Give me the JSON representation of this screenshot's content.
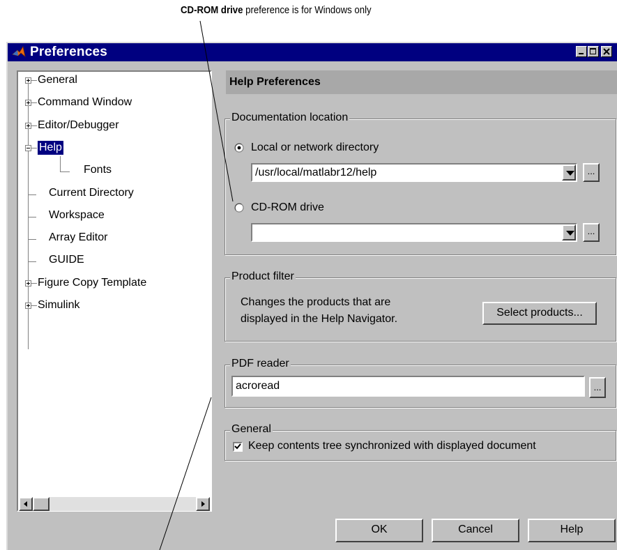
{
  "annotations": {
    "top_bold": "CD-ROM drive",
    "top_rest": " preference is for Windows only"
  },
  "window": {
    "title": "Preferences",
    "controls": [
      "minimize",
      "maximize",
      "close"
    ]
  },
  "tree": {
    "items": [
      {
        "label": "General",
        "expander": "plus"
      },
      {
        "label": "Command Window",
        "expander": "plus"
      },
      {
        "label": "Editor/Debugger",
        "expander": "plus"
      },
      {
        "label": "Help",
        "expander": "minus",
        "selected": true
      },
      {
        "label": "Fonts",
        "expander": "none"
      },
      {
        "label": "Current Directory",
        "expander": "none"
      },
      {
        "label": "Workspace",
        "expander": "none"
      },
      {
        "label": "Array Editor",
        "expander": "none"
      },
      {
        "label": "GUIDE",
        "expander": "none"
      },
      {
        "label": "Figure Copy Template",
        "expander": "plus"
      },
      {
        "label": "Simulink",
        "expander": "plus"
      }
    ]
  },
  "panel": {
    "header": "Help Preferences",
    "doc_location": {
      "title": "Documentation location",
      "local_label": "Local or network directory",
      "local_value": "/usr/local/matlabr12/help",
      "cdrom_label": "CD-ROM drive",
      "cdrom_value": "",
      "selected": "local",
      "browse_label": "..."
    },
    "product_filter": {
      "title": "Product filter",
      "text_line1": "Changes the products that are",
      "text_line2": "displayed in the Help Navigator.",
      "button": "Select products..."
    },
    "pdf_reader": {
      "title": "PDF reader",
      "value": "acroread",
      "browse_label": "..."
    },
    "general": {
      "title": "General",
      "checkbox_label": "Keep contents tree synchronized with displayed document",
      "checked": true
    }
  },
  "buttons": {
    "ok": "OK",
    "cancel": "Cancel",
    "help": "Help"
  },
  "colors": {
    "titlebar": "#000080",
    "face": "#c0c0c0",
    "header": "#a8a8a8",
    "selection": "#000080"
  }
}
